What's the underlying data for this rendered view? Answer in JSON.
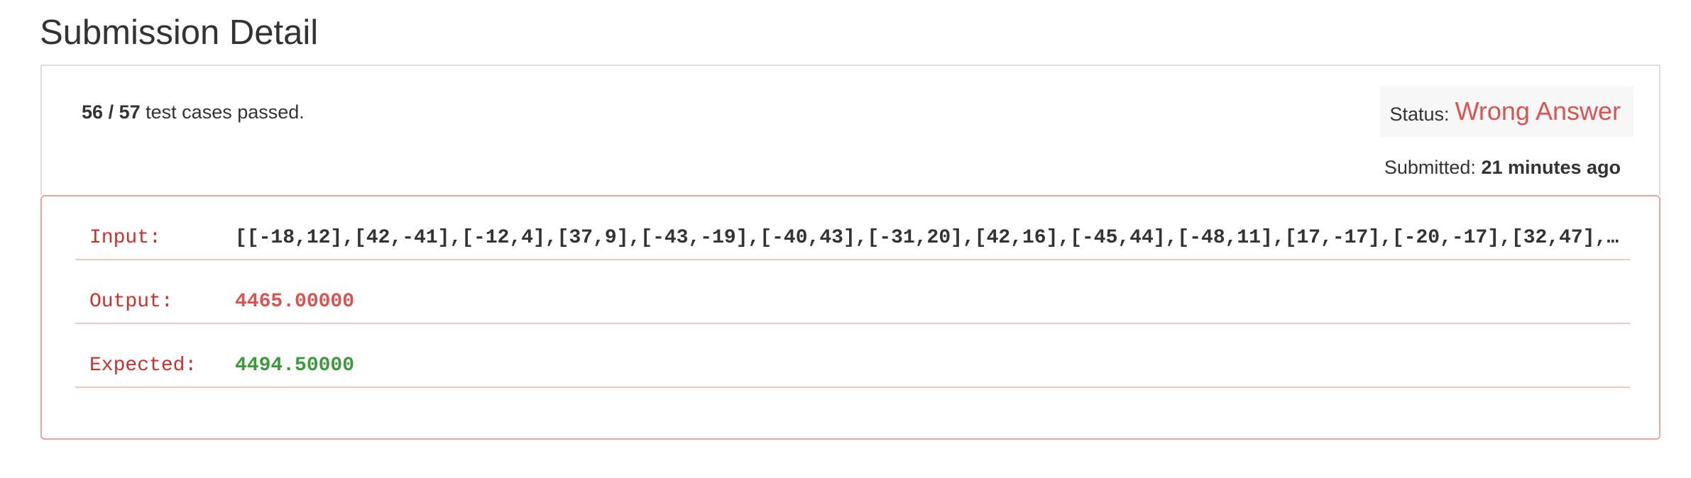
{
  "page": {
    "title": "Submission Detail"
  },
  "summary": {
    "passed": "56",
    "separator": "/",
    "total": "57",
    "suffix": "test cases passed.",
    "status_label": "Status:",
    "status_value": "Wrong Answer",
    "submitted_label": "Submitted:",
    "submitted_value": "21 minutes ago"
  },
  "result": {
    "input_label": "Input:",
    "input_value": "[[-18,12],[42,-41],[-12,4],[37,9],[-43,-19],[-40,43],[-31,20],[42,16],[-45,44],[-48,11],[17,-17],[-20,-17],[32,47],…",
    "output_label": "Output:",
    "output_value": "4465.00000",
    "expected_label": "Expected:",
    "expected_value": "4494.50000"
  },
  "colors": {
    "error": "#d9534f",
    "success": "#3c9a3c",
    "text": "#333333",
    "border": "#dddddd",
    "error_border": "#e7a7a5"
  }
}
